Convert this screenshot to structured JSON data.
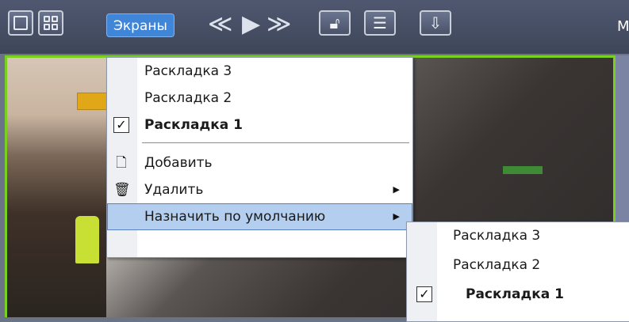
{
  "toolbar": {
    "screens_label": "Экраны",
    "nav_prev_glyph": "≪",
    "nav_play_glyph": "▶",
    "nav_next_glyph": "≫",
    "right_letter": "М",
    "icons": [
      "single-view-icon",
      "grid-view-icon",
      "rewind-icon",
      "play-icon",
      "fast-forward-icon",
      "lock-icon",
      "list-icon",
      "download-icon"
    ]
  },
  "menu": {
    "items": [
      {
        "label": "Раскладка 3",
        "checked": false
      },
      {
        "label": "Раскладка 2",
        "checked": false
      },
      {
        "label": "Раскладка 1",
        "checked": true,
        "bold": true
      },
      {
        "label": "Добавить",
        "icon": "document-icon"
      },
      {
        "label": "Удалить",
        "icon": "trash-icon",
        "has_submenu": true
      },
      {
        "label": "Назначить по умолчанию",
        "has_submenu": true,
        "highlighted": true
      }
    ]
  },
  "submenu": {
    "items": [
      {
        "label": "Раскладка 3",
        "checked": false
      },
      {
        "label": "Раскладка 2",
        "checked": false
      },
      {
        "label": "Раскладка 1",
        "checked": true,
        "bold": true
      }
    ]
  },
  "colors": {
    "toolbar_bg": "#4a5369",
    "screens_button": "#3f86d8",
    "active_border": "#7ad01f",
    "menu_highlight": "#b3ceef"
  }
}
